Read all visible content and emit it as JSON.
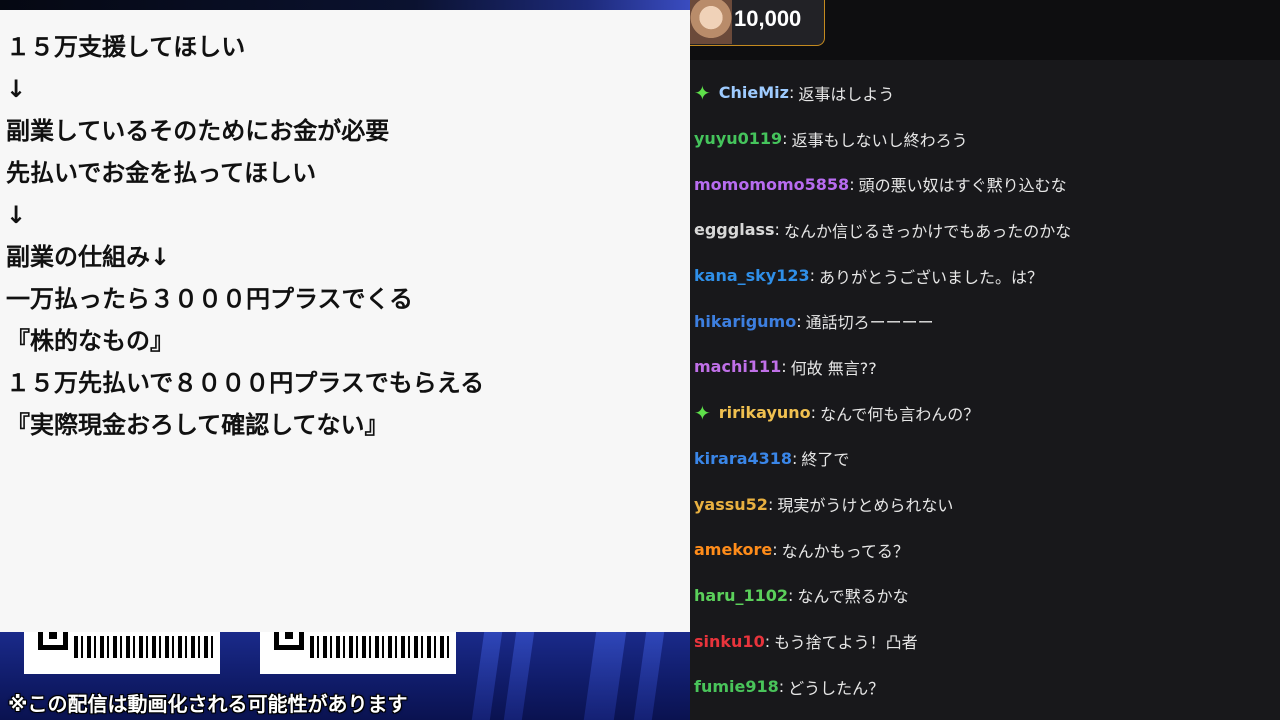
{
  "note": {
    "lines": [
      "１５万支援してほしい",
      "↓",
      "副業しているそのためにお金が必要",
      "先払いでお金を払ってほしい",
      "↓",
      "副業の仕組み↓",
      "一万払ったら３０００円プラスでくる",
      "『株的なもの』",
      "１５万先払いで８０００円プラスでもらえる",
      "『実際現金おろして確認してない』"
    ]
  },
  "overlay": {
    "disclaimer": "※この配信は動画化される可能性があります"
  },
  "chat": {
    "bits_total": "10,000",
    "messages": [
      {
        "user": "ChieMiz",
        "text": "返事はしよう",
        "color": "#9ecbff",
        "badge": true
      },
      {
        "user": "yuyu0119",
        "text": "返事もしないし終わろう",
        "color": "#45c45c",
        "badge": false
      },
      {
        "user": "momomomo5858",
        "text": "頭の悪い奴はすぐ黙り込むな",
        "color": "#b86cf0",
        "badge": false
      },
      {
        "user": "eggglass",
        "text": "なんか信じるきっかけでもあったのかな",
        "color": "#d8d8d8",
        "badge": false
      },
      {
        "user": "kana_sky123",
        "text": "ありがとうございました。は？",
        "color": "#2f8fe8",
        "badge": false
      },
      {
        "user": "hikarigumo",
        "text": "通話切ろーーーー",
        "color": "#3d7fe0",
        "badge": false
      },
      {
        "user": "machi111",
        "text": "何故 無言??",
        "color": "#c070e8",
        "badge": false
      },
      {
        "user": "ririkayuno",
        "text": "なんで何も言わんの？",
        "color": "#f0c050",
        "badge": true
      },
      {
        "user": "kirara4318",
        "text": "終了で",
        "color": "#3a86e8",
        "badge": false
      },
      {
        "user": "yassu52",
        "text": "現実がうけとめられない",
        "color": "#e8b040",
        "badge": false
      },
      {
        "user": "amekore",
        "text": "なんかもってる？",
        "color": "#ff8c1a",
        "badge": false
      },
      {
        "user": "haru_1102",
        "text": "なんで黙るかな",
        "color": "#5bd05b",
        "badge": false
      },
      {
        "user": "sinku10",
        "text": "もう捨てよう！凸者",
        "color": "#e8343c",
        "badge": false
      },
      {
        "user": "fumie918",
        "text": "どうしたん？",
        "color": "#49c45a",
        "badge": false
      }
    ]
  }
}
